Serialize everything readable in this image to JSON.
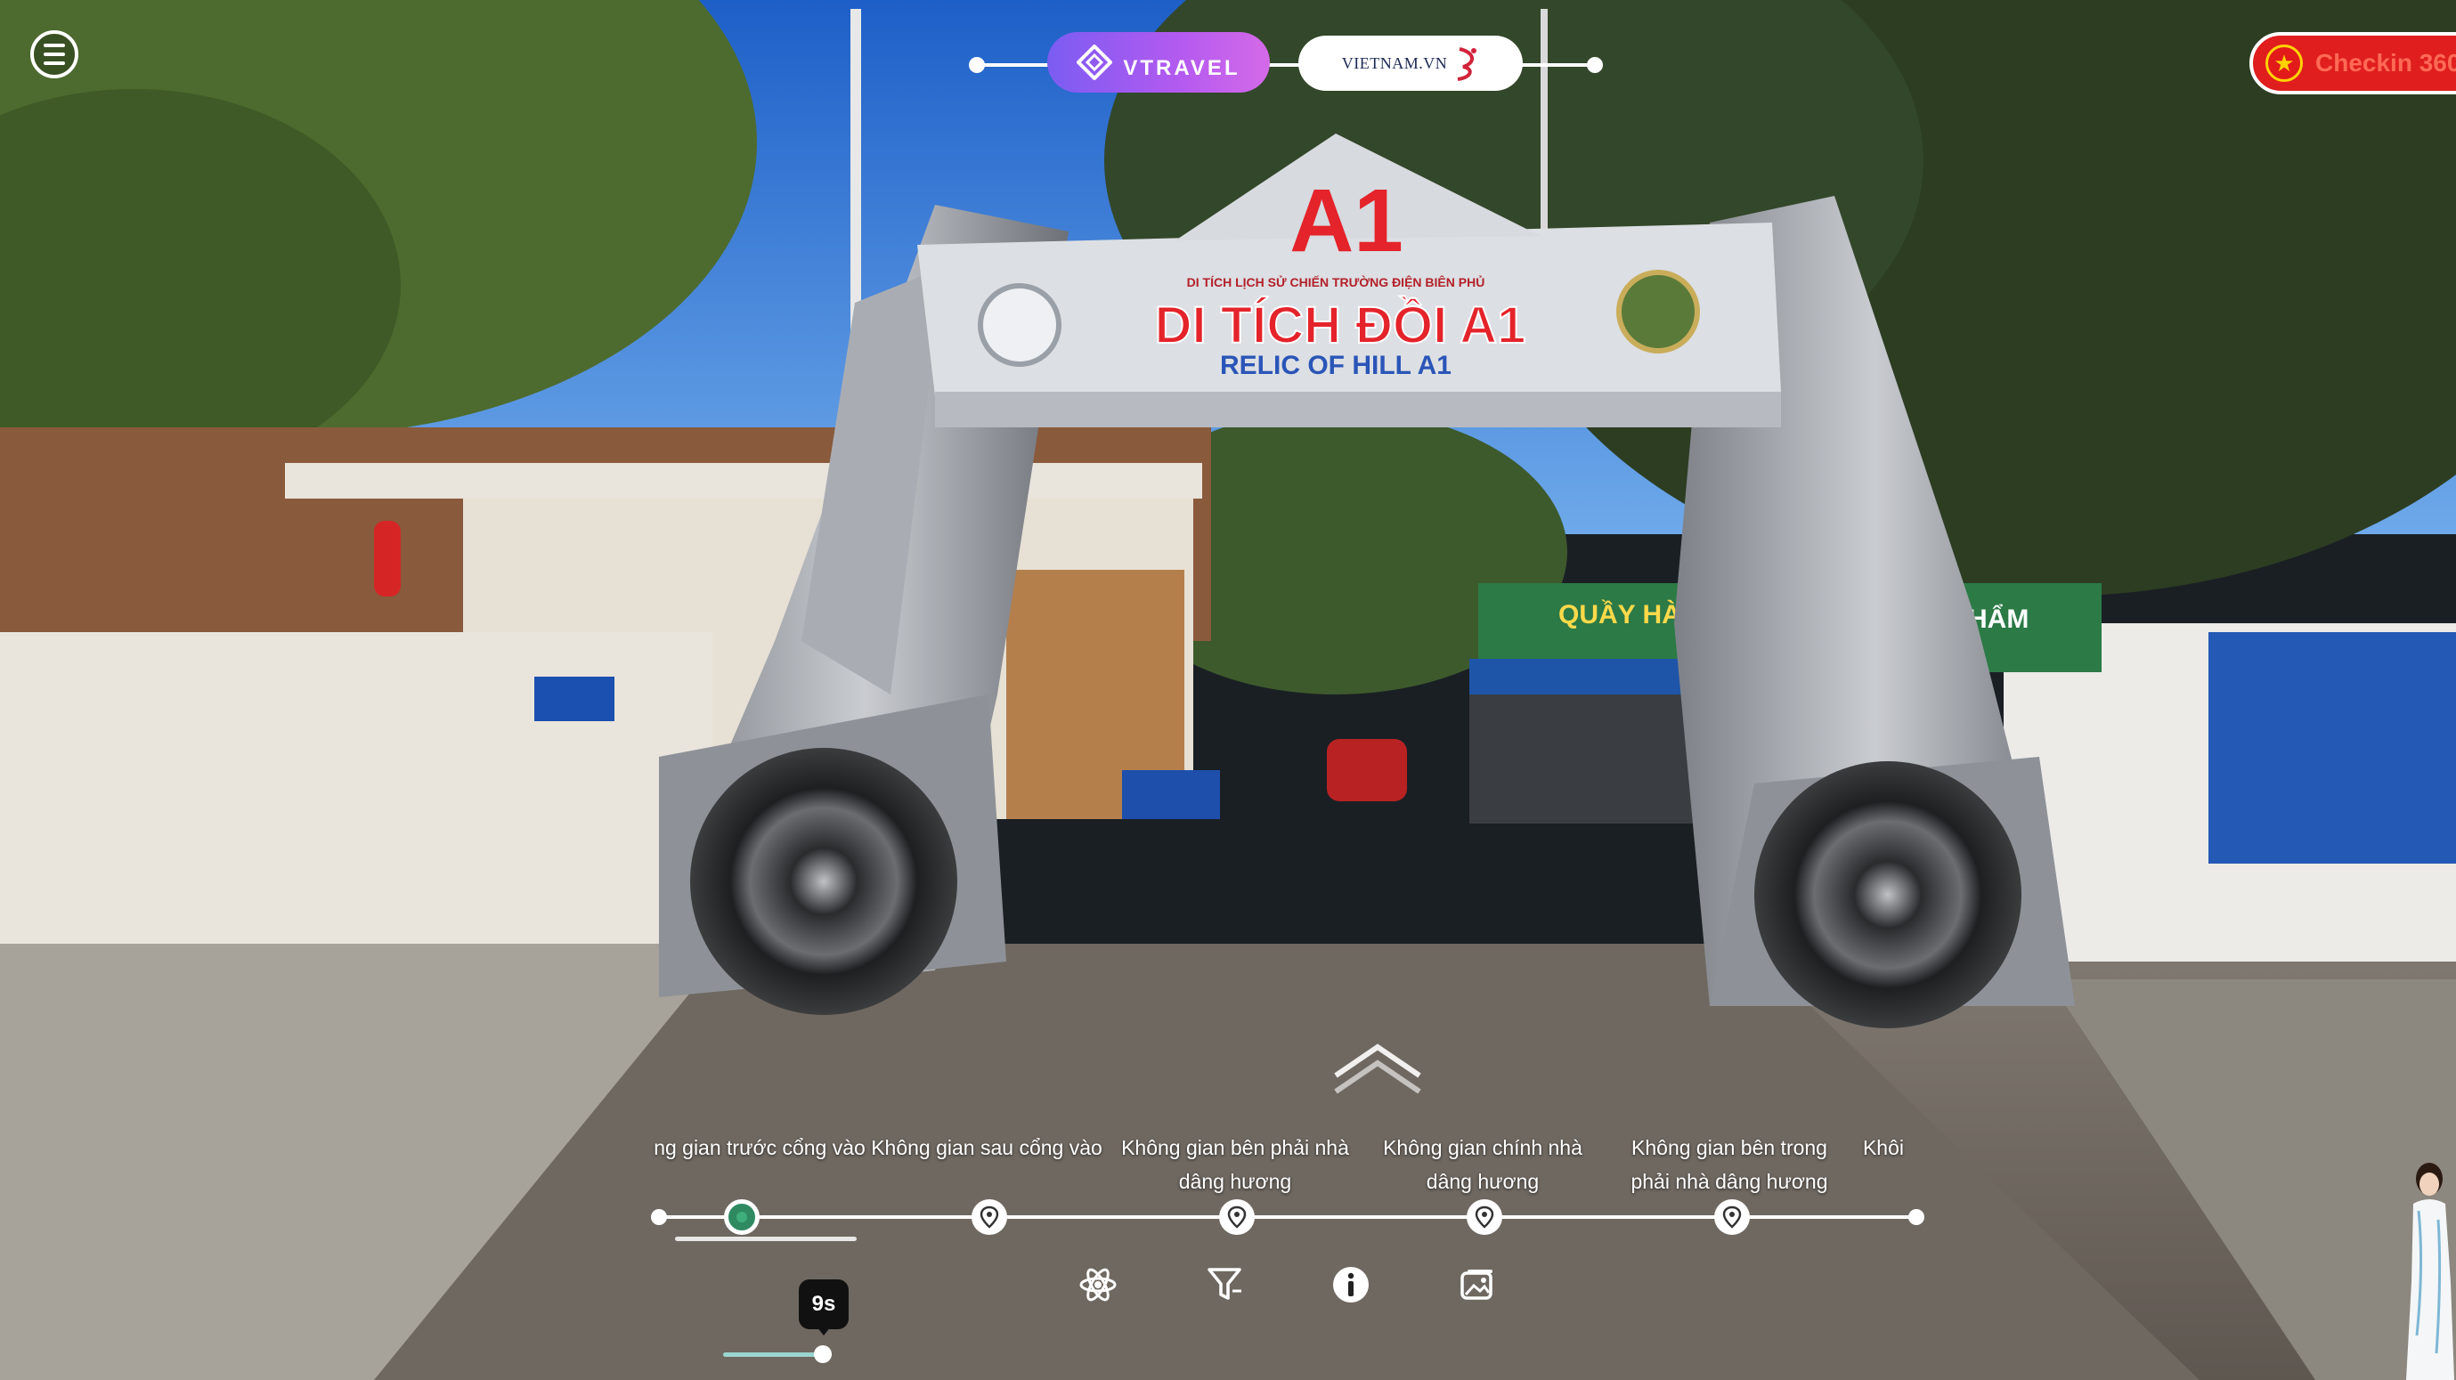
{
  "header": {
    "brand_primary": "VTRAVEL",
    "brand_secondary": "VIETNAM.VN",
    "checkin_label": "Checkin 360"
  },
  "scene_sign": {
    "big_text": "A1",
    "small_text": "DI TÍCH LỊCH SỬ CHIẾN TRƯỜNG ĐIỆN BIÊN PHỦ",
    "main_text": "DI TÍCH ĐỒI A1",
    "sub_text": "RELIC OF HILL A1",
    "shop_text": "QUẦY HÀN",
    "shop_text_2": "PHẨM"
  },
  "timeline": {
    "scenes": [
      {
        "label": "ng gian trước cổng vào",
        "active": true
      },
      {
        "label": "Không gian sau cổng vào",
        "active": false
      },
      {
        "label": "Không gian bên phải nhà dâng hương",
        "active": false
      },
      {
        "label": "Không gian chính nhà dâng hương",
        "active": false
      },
      {
        "label": "Không gian bên trong phải nhà dâng hương",
        "active": false
      },
      {
        "label": "Khôi",
        "active": false
      }
    ]
  },
  "toolbar": {
    "timer_label": "9s",
    "icons": [
      "atom-icon",
      "filter-icon",
      "info-icon",
      "gallery-icon"
    ]
  },
  "colors": {
    "brand_gradient_start": "#7b5cf2",
    "brand_gradient_end": "#d46ae8",
    "checkin_red": "#e01e1e",
    "active_marker": "#2f8a62"
  }
}
